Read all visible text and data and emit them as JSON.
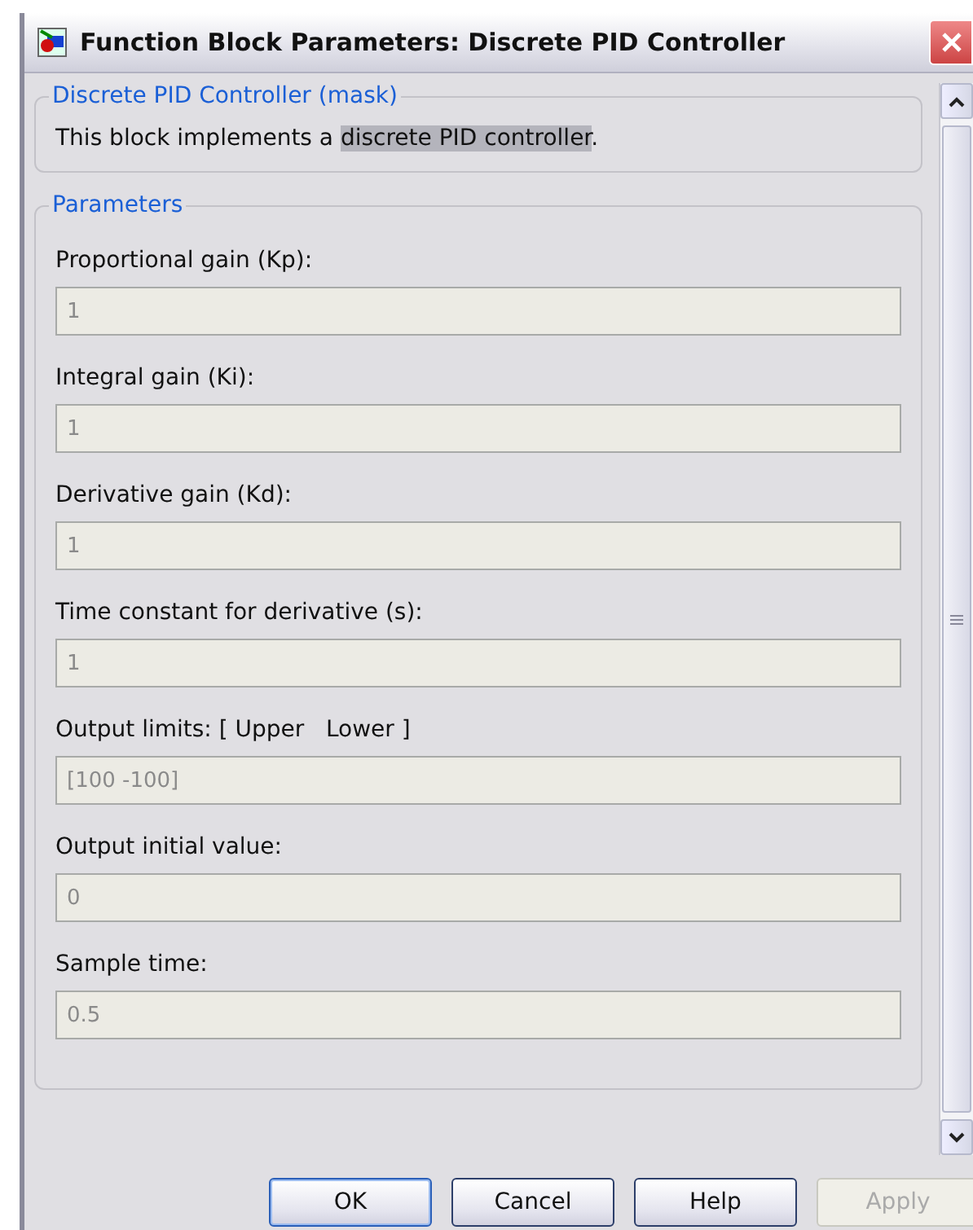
{
  "window": {
    "title": "Function Block Parameters: Discrete PID Controller"
  },
  "mask": {
    "title": "Discrete PID Controller (mask)",
    "description": {
      "before": "This block implements a ",
      "selected": "discrete PID controller",
      "after": "."
    }
  },
  "parameters": {
    "title": "Parameters",
    "items": [
      {
        "label": "Proportional gain (Kp):",
        "value": "1",
        "disabled": true
      },
      {
        "label": "Integral gain (Ki):",
        "value": "1",
        "disabled": true
      },
      {
        "label": "Derivative gain (Kd):",
        "value": "1",
        "disabled": true
      },
      {
        "label": "Time constant for derivative (s):",
        "value": "1",
        "disabled": true
      },
      {
        "label": "Output limits: [ Upper   Lower ]",
        "value": "[100 -100]",
        "disabled": true
      },
      {
        "label": "Output initial value:",
        "value": "0",
        "disabled": true
      },
      {
        "label": "Sample time:",
        "value": "0.5",
        "disabled": true
      }
    ]
  },
  "buttons": [
    {
      "label": "OK",
      "disabled": false,
      "default": true
    },
    {
      "label": "Cancel",
      "disabled": false,
      "default": false
    },
    {
      "label": "Help",
      "disabled": false,
      "default": false
    },
    {
      "label": "Apply",
      "disabled": true,
      "default": false
    }
  ]
}
